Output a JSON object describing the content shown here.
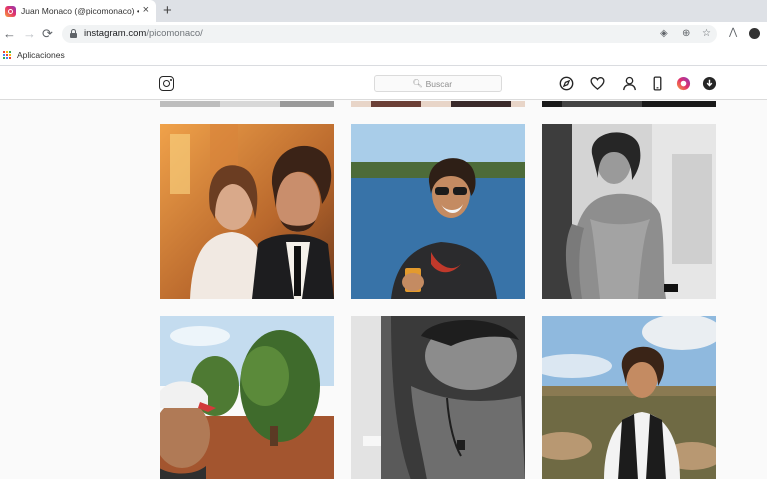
{
  "browser": {
    "tab_title": "Juan Monaco (@picomonaco) • I",
    "tab_close": "×",
    "new_tab": "+",
    "url_host": "instagram.com",
    "url_path": "/picomonaco/",
    "bookmarks_label": "Aplicaciones"
  },
  "instagram": {
    "search_placeholder": "Buscar"
  },
  "posts": [
    {
      "icon": "post-partial-top-left"
    },
    {
      "icon": "post-partial-top-center"
    },
    {
      "icon": "post-partial-top-right"
    },
    {
      "icon": "post-couple-selfie"
    },
    {
      "icon": "post-lake-drink"
    },
    {
      "icon": "post-shirtless-bw"
    },
    {
      "icon": "post-cap-selfie-trees"
    },
    {
      "icon": "post-bw-closeup"
    },
    {
      "icon": "post-vest-landscape"
    }
  ],
  "colors": {
    "ig_border": "#dbdbdb",
    "ig_text": "#262626",
    "chrome_tabstrip": "#dee1e6"
  }
}
